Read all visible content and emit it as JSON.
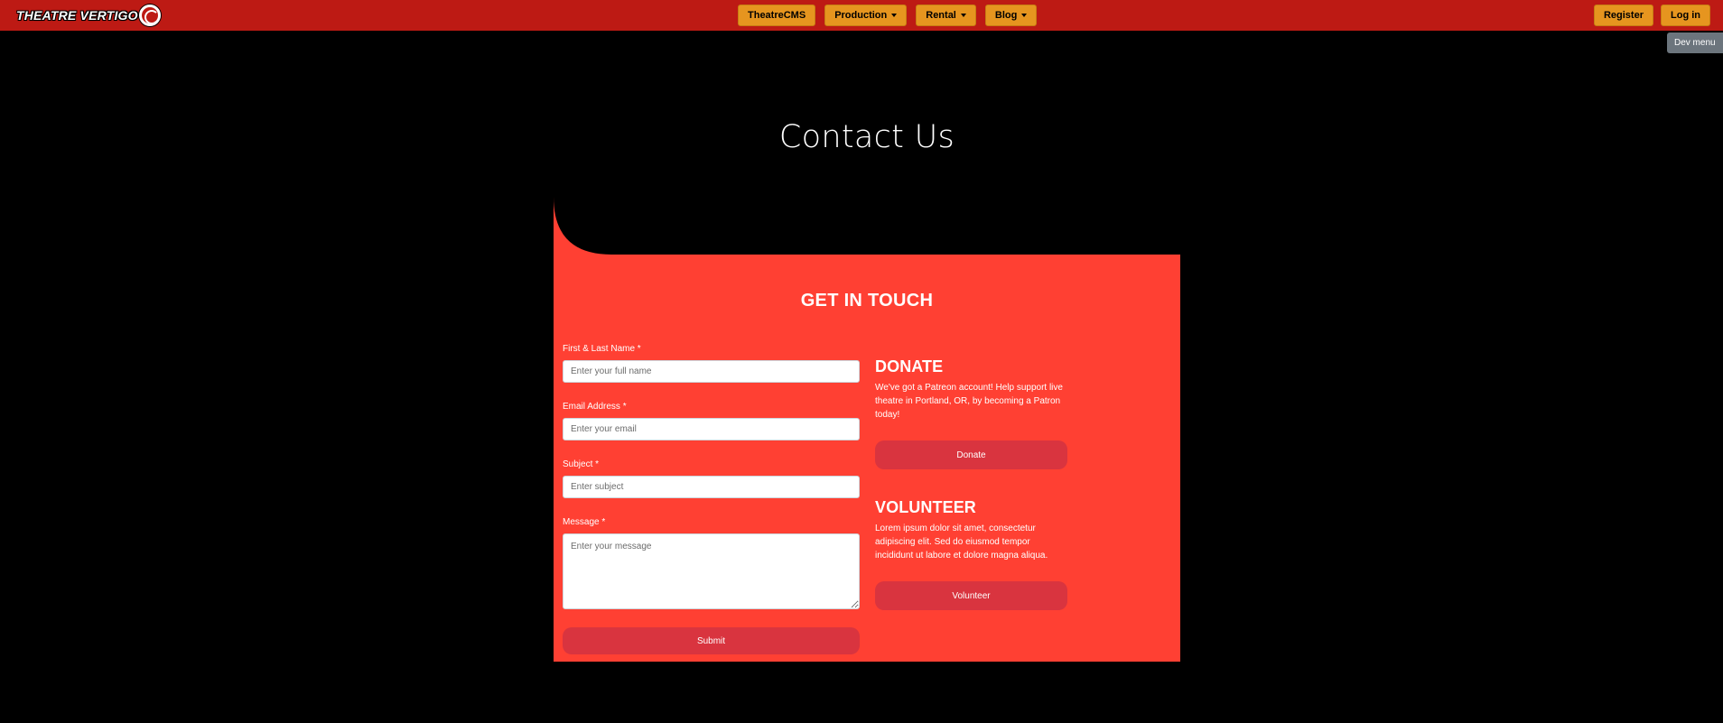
{
  "navbar": {
    "logo_text": "THEATRE VERTIGO",
    "center_items": [
      {
        "label": "TheatreCMS",
        "dropdown": false
      },
      {
        "label": "Production",
        "dropdown": true
      },
      {
        "label": "Rental",
        "dropdown": true
      },
      {
        "label": "Blog",
        "dropdown": true
      }
    ],
    "register_label": "Register",
    "login_label": "Log in",
    "dev_menu_label": "Dev menu"
  },
  "hero": {
    "title": "Contact Us"
  },
  "contact": {
    "heading": "GET IN TOUCH",
    "form": {
      "name_label": "First & Last Name *",
      "name_placeholder": "Enter your full name",
      "email_label": "Email Address *",
      "email_placeholder": "Enter your email",
      "subject_label": "Subject *",
      "subject_placeholder": "Enter subject",
      "message_label": "Message *",
      "message_placeholder": "Enter your message",
      "submit_label": "Submit"
    },
    "donate": {
      "heading": "DONATE",
      "text": "We've got a Patreon account! Help support live theatre in Portland, OR, by becoming a Patron today!",
      "button_label": "Donate"
    },
    "volunteer": {
      "heading": "VOLUNTEER",
      "text": "Lorem ipsum dolor sit amet, consectetur adipiscing elit. Sed do eiusmod tempor incididunt ut labore et dolore magna aliqua.",
      "button_label": "Volunteer"
    }
  },
  "colors": {
    "navbar_bg": "#bd1a14",
    "nav_button_bg": "#e6951f",
    "card_bg": "#ff4033",
    "pill_button_bg": "#d9343f",
    "page_bg": "#000000",
    "dev_menu_bg": "#6c757d"
  }
}
